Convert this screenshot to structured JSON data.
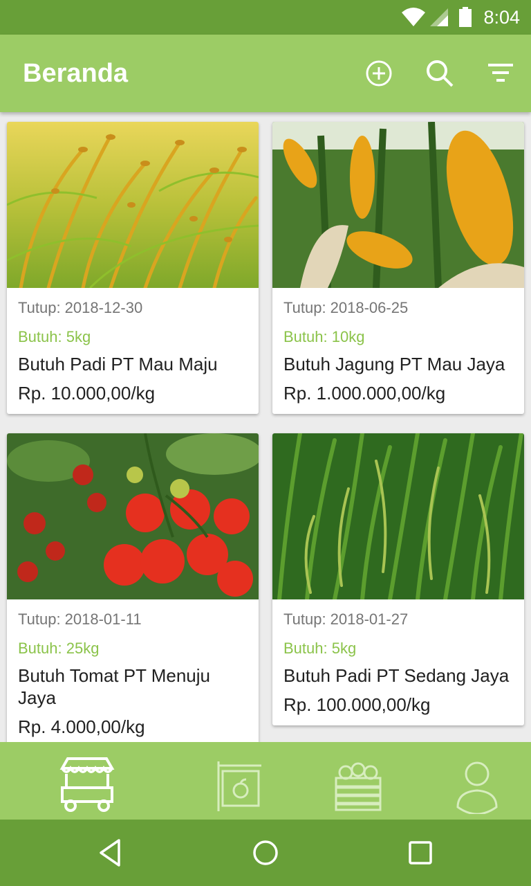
{
  "status_bar": {
    "time": "8:04",
    "icons": [
      "wifi-icon",
      "signal-icon",
      "battery-icon"
    ]
  },
  "app_bar": {
    "title": "Beranda",
    "actions": [
      "add-circle-icon",
      "search-icon",
      "filter-icon"
    ]
  },
  "colors": {
    "primary_dark": "#689f38",
    "primary": "#9ccc65",
    "accent_text": "#8bc34a"
  },
  "listings": [
    {
      "date": "Tutup: 2018-12-30",
      "need": "Butuh: 5kg",
      "name": "Butuh Padi PT Mau Maju",
      "price": "Rp. 10.000,00/kg",
      "image": "ripe-rice-photo"
    },
    {
      "date": "Tutup: 2018-06-25",
      "need": "Butuh: 10kg",
      "name": "Butuh Jagung PT Mau Jaya",
      "price": "Rp. 1.000.000,00/kg",
      "image": "corn-photo"
    },
    {
      "date": "Tutup: 2018-01-11",
      "need": "Butuh: 25kg",
      "name": "Butuh Tomat PT Menuju Jaya",
      "price": "Rp. 4.000,00/kg",
      "image": "tomato-photo"
    },
    {
      "date": "Tutup: 2018-01-27",
      "need": "Butuh: 5kg",
      "name": "Butuh Padi PT Sedang Jaya",
      "price": "Rp. 100.000,00/kg",
      "image": "green-rice-photo"
    }
  ],
  "bottom_nav": [
    "market-stall-icon",
    "shop-sign-icon",
    "produce-crate-icon",
    "profile-icon"
  ],
  "system_nav": [
    "back-icon",
    "home-icon",
    "recents-icon"
  ]
}
